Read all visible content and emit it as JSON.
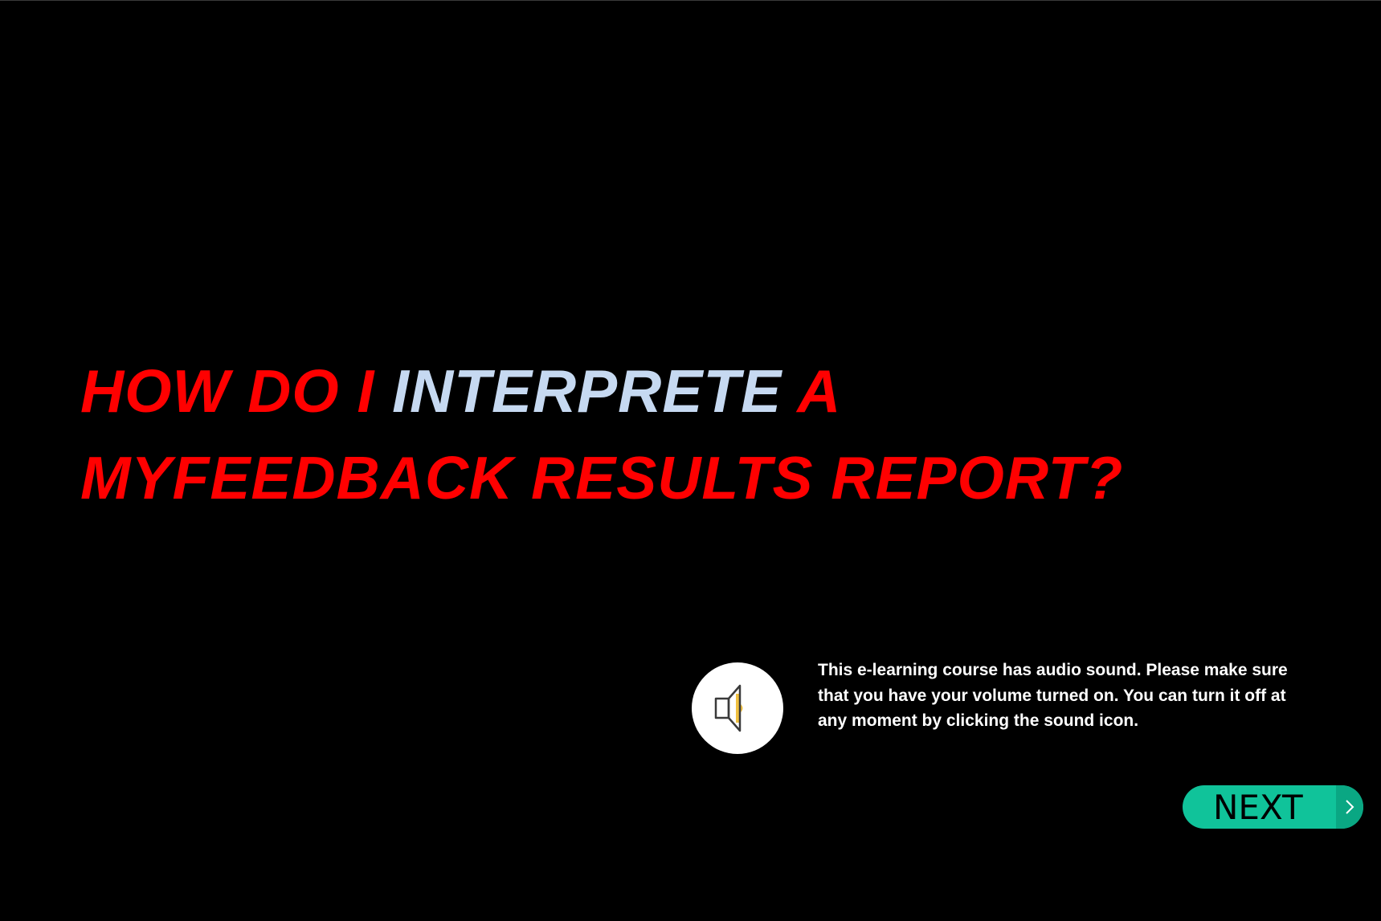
{
  "title": {
    "line1_before": "HOW DO I ",
    "line1_highlight": "INTERPRETE",
    "line1_after": " A",
    "line2": "MYFEEDBACK RESULTS REPORT?"
  },
  "audio_notice": "This e-learning course has audio sound. Please make sure that you have your volume turned on. You can turn it off at any moment by clicking the sound icon.",
  "navigation": {
    "next_label": "NEXT"
  },
  "icons": {
    "sound": "speaker-icon",
    "next_arrow": "chevron-right-icon"
  },
  "colors": {
    "background": "#000000",
    "title": "#ff0000",
    "title_highlight": "#c6d9f1",
    "notice_text": "#ffffff",
    "next_button": "#10c39a",
    "speaker_accent": "#f0c040"
  }
}
